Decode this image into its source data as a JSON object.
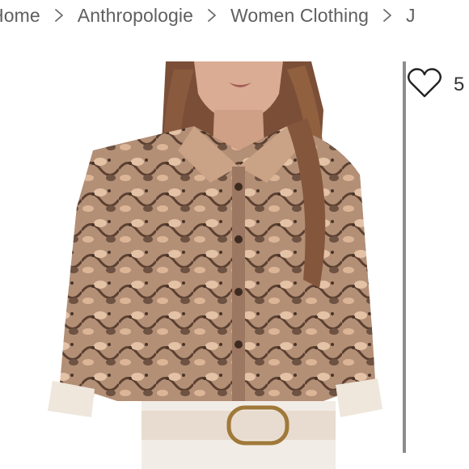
{
  "breadcrumb": {
    "items": [
      "Home",
      "Anthropologie",
      "Women Clothing",
      "J"
    ]
  },
  "product": {
    "image_alt": "Snakeskin print jacket"
  },
  "likes": {
    "icon": "heart-outline-icon",
    "count": "5"
  },
  "colors": {
    "breadcrumb_text": "#5f5f5f",
    "divider": "#8c8c8c"
  }
}
